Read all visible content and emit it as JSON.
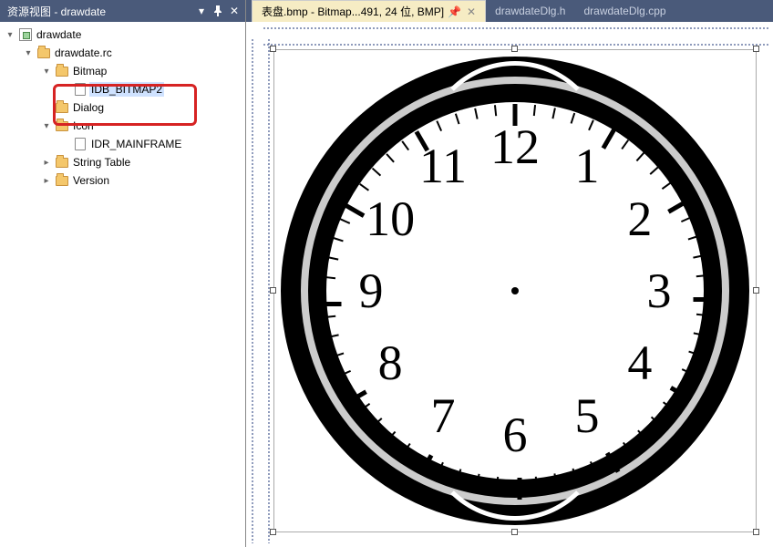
{
  "panel": {
    "title": "资源视图 - drawdate",
    "tree": [
      {
        "level": 0,
        "expand": "▾",
        "icon": "rc",
        "label": "drawdate",
        "selected": false
      },
      {
        "level": 1,
        "expand": "▾",
        "icon": "folder",
        "label": "drawdate.rc",
        "selected": false
      },
      {
        "level": 2,
        "expand": "▾",
        "icon": "folder",
        "label": "Bitmap",
        "selected": false
      },
      {
        "level": 3,
        "expand": "",
        "icon": "doc",
        "label": "IDB_BITMAP2",
        "selected": true
      },
      {
        "level": 2,
        "expand": "",
        "icon": "folder",
        "label": "Dialog",
        "selected": false
      },
      {
        "level": 2,
        "expand": "▾",
        "icon": "folder",
        "label": "Icon",
        "selected": false
      },
      {
        "level": 3,
        "expand": "",
        "icon": "doc",
        "label": "IDR_MAINFRAME",
        "selected": false
      },
      {
        "level": 2,
        "expand": "▸",
        "icon": "folder",
        "label": "String Table",
        "selected": false
      },
      {
        "level": 2,
        "expand": "▸",
        "icon": "folder",
        "label": "Version",
        "selected": false
      }
    ]
  },
  "tabs": [
    {
      "label": "表盘.bmp - Bitmap...491, 24 位, BMP]",
      "active": true,
      "pinned": true,
      "closable": true
    },
    {
      "label": "drawdateDlg.h",
      "active": false,
      "pinned": false,
      "closable": false
    },
    {
      "label": "drawdateDlg.cpp",
      "active": false,
      "pinned": false,
      "closable": false
    }
  ],
  "clock": {
    "numerals": [
      "12",
      "1",
      "2",
      "3",
      "4",
      "5",
      "6",
      "7",
      "8",
      "9",
      "10",
      "11"
    ]
  }
}
